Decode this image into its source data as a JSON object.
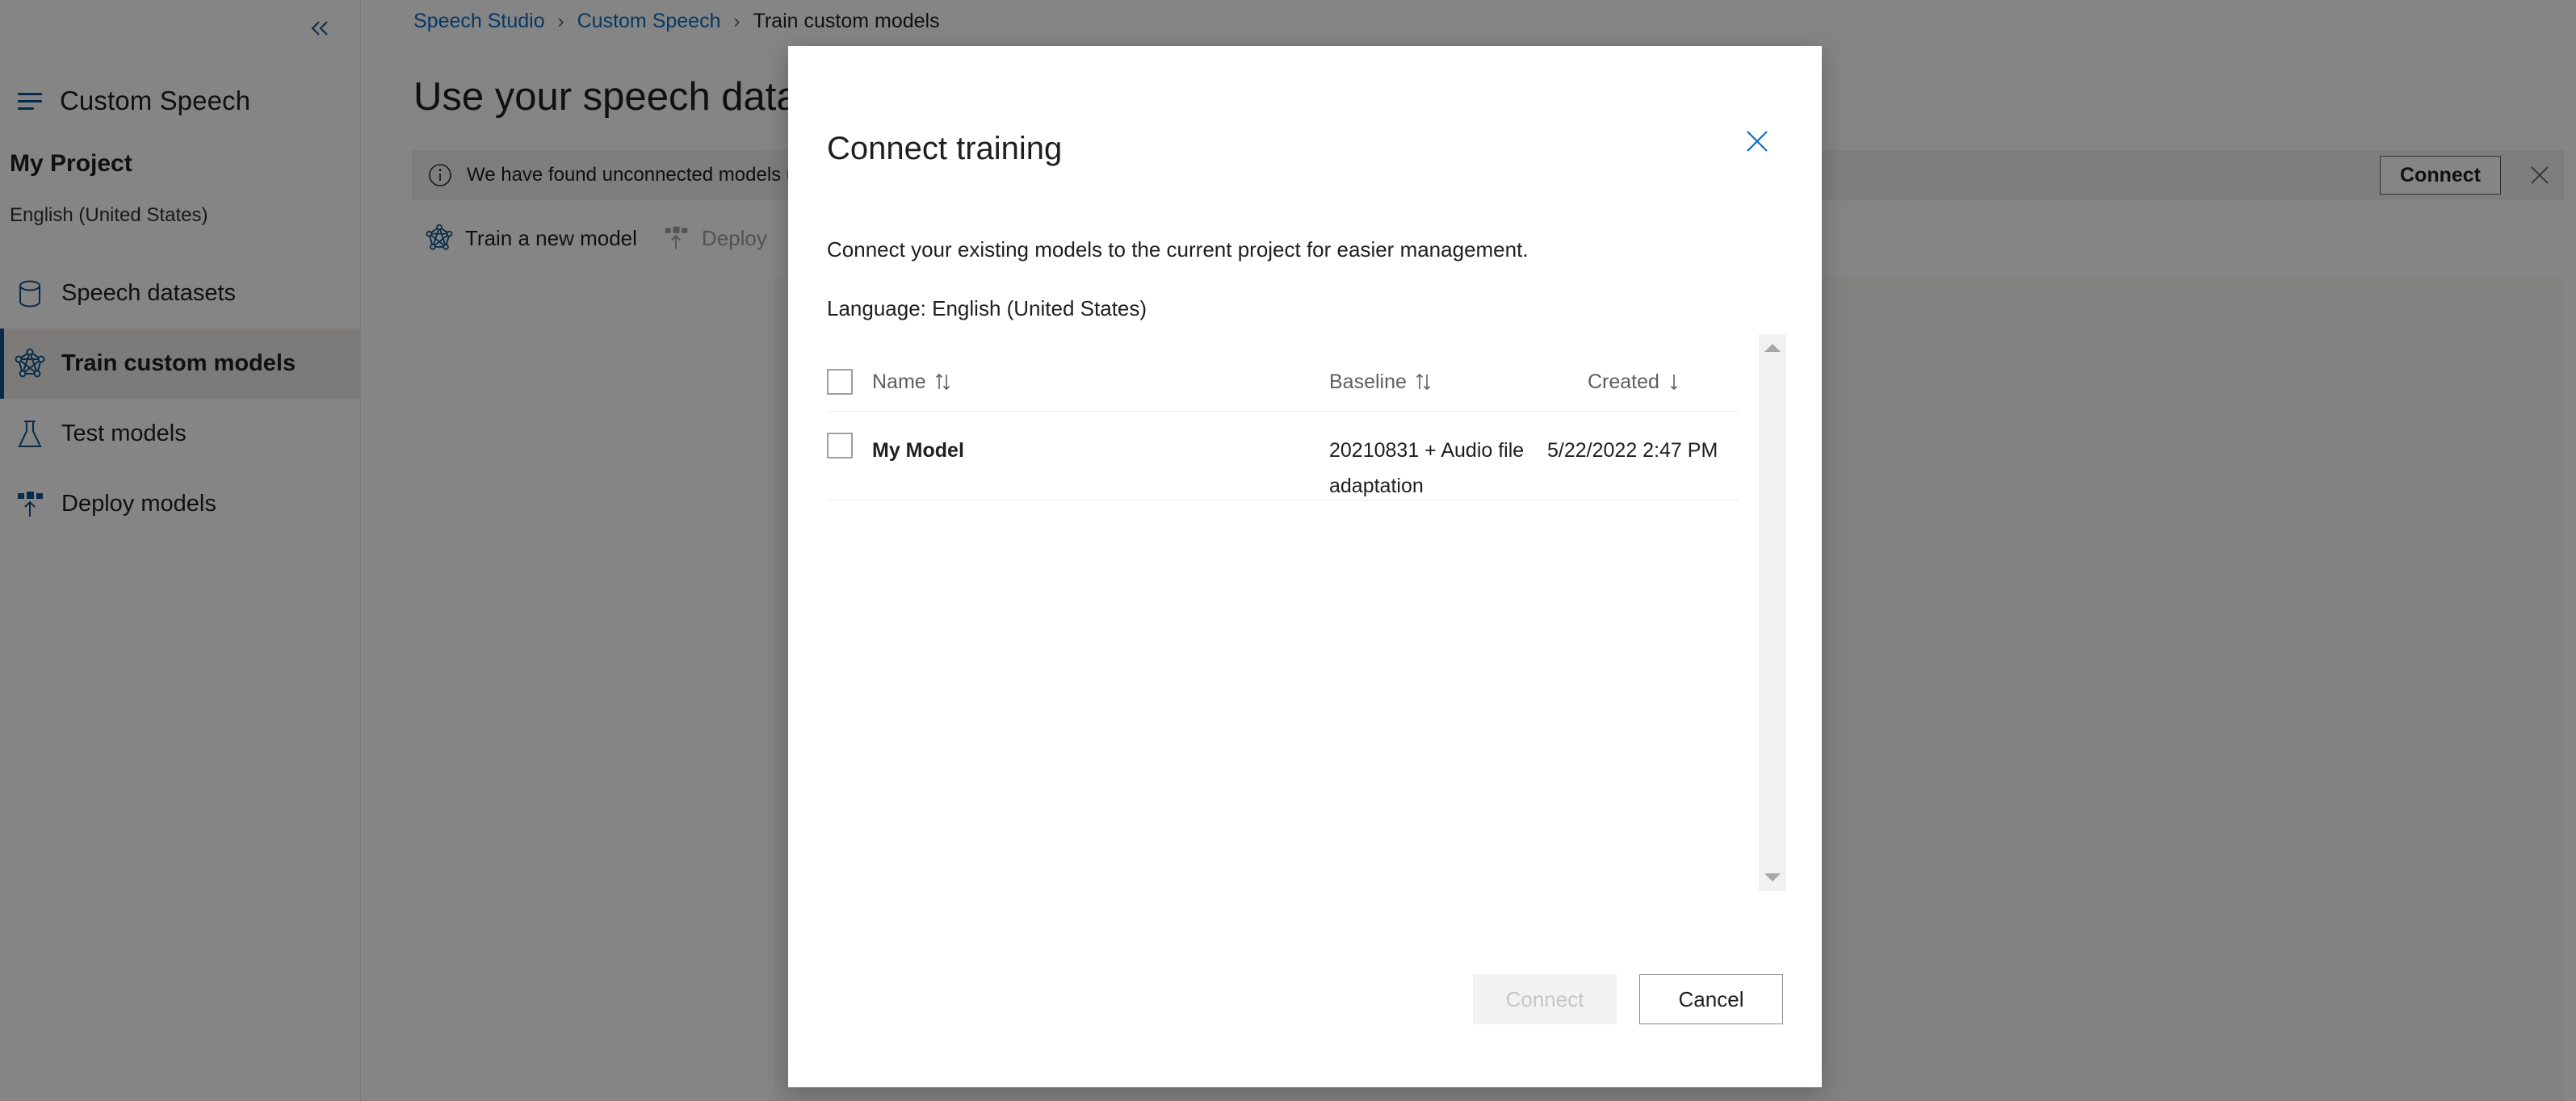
{
  "sidebar": {
    "collapse_icon": "chevron-double-left-icon",
    "brand": "Custom Speech",
    "brand_icon": "hamburger-menu-icon",
    "project_name": "My Project",
    "project_locale": "English (United States)",
    "items": [
      {
        "label": "Speech datasets",
        "icon": "database-icon",
        "selected": false
      },
      {
        "label": "Train custom models",
        "icon": "network-icon",
        "selected": true
      },
      {
        "label": "Test models",
        "icon": "flask-icon",
        "selected": false
      },
      {
        "label": "Deploy models",
        "icon": "deploy-icon",
        "selected": false
      }
    ]
  },
  "breadcrumb": {
    "items": [
      "Speech Studio",
      "Custom Speech",
      "Train custom models"
    ],
    "separator": "›"
  },
  "main": {
    "page_title": "Use your speech data",
    "message_bar": {
      "icon": "info-icon",
      "text": "We have found unconnected models                                                              u want to connect these entities to this project so you can …",
      "connect_label": "Connect",
      "close_icon": "close-icon"
    },
    "command_bar": {
      "train_label": "Train a new model",
      "train_icon": "network-icon",
      "deploy_label": "Deploy",
      "deploy_icon": "deploy-icon"
    }
  },
  "modal": {
    "title": "Connect training",
    "close_icon": "close-icon",
    "description": "Connect your existing models to the current project for easier management.",
    "language": "Language: English (United States)",
    "table": {
      "columns": [
        {
          "label": "Name",
          "sort_icon": "sort-both-icon"
        },
        {
          "label": "Baseline",
          "sort_icon": "sort-both-icon"
        },
        {
          "label": "Created",
          "sort_icon": "sort-down-icon"
        }
      ],
      "rows": [
        {
          "checked": false,
          "name": "My Model",
          "baseline": "20210831 + Audio file adaptation",
          "created": "5/22/2022 2:47 PM"
        }
      ]
    },
    "scrollbar": {
      "up_icon": "caret-up-icon",
      "down_icon": "caret-down-icon"
    },
    "footer": {
      "connect_label": "Connect",
      "cancel_label": "Cancel"
    }
  },
  "colors": {
    "accent_blue": "#0f548c",
    "link_blue": "#0f6cbd",
    "close_blue": "#0f6cbd",
    "text_primary": "#201f1e",
    "text_secondary": "#605e5c",
    "disabled_text": "#a19f9d",
    "selected_nav_bg": "#edebe9",
    "message_bar_bg": "#f3f2f1",
    "panel_bg": "#faf9f8",
    "overlay": "rgba(0,0,0,0.48)"
  }
}
